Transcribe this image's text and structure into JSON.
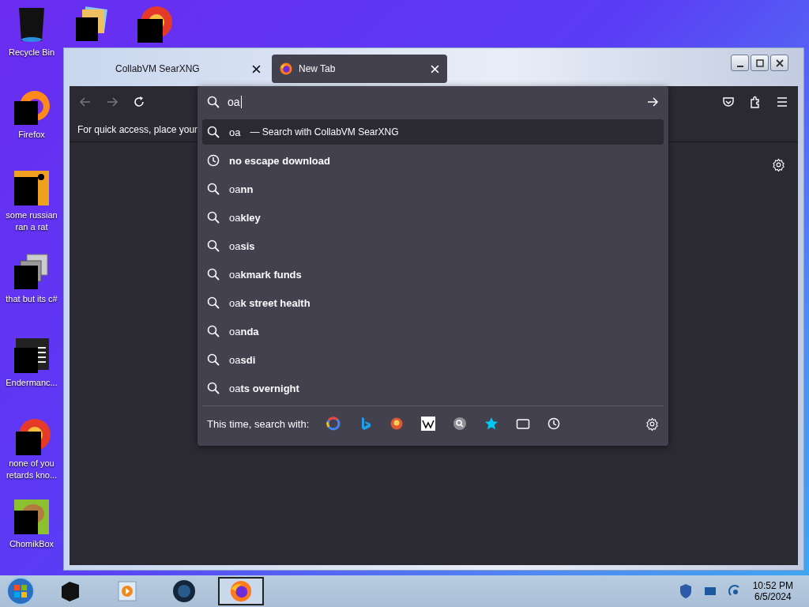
{
  "desktop_icons": [
    {
      "label": "Recycle Bin",
      "kind": "bin"
    },
    {
      "kind": "folder"
    },
    {
      "kind": "disc"
    },
    {
      "label": "Firefox",
      "kind": "firefox"
    },
    {
      "label": "some russian ran a rat",
      "kind": "doc"
    },
    {
      "label": "that but its c#",
      "kind": "stack"
    },
    {
      "label": "Endermanc...",
      "kind": "terminal"
    },
    {
      "label": "none of you retards kno...",
      "kind": "disc"
    },
    {
      "label": "ChomikBox",
      "kind": "box"
    }
  ],
  "tabs": [
    {
      "label": "CollabVM SearXNG",
      "selected": false
    },
    {
      "label": "New Tab",
      "selected": true
    }
  ],
  "bookmarks_bar": {
    "text": "For quick access, place your"
  },
  "address_bar": {
    "value": "oa"
  },
  "suggestions": [
    {
      "kind": "search",
      "text": "oa",
      "note": "— Search with CollabVM SearXNG",
      "selected": true
    },
    {
      "kind": "history",
      "text": "**no escape download**",
      "selected": false
    },
    {
      "kind": "search",
      "text": "oa**nn**",
      "selected": false
    },
    {
      "kind": "search",
      "text": "oa**kley**",
      "selected": false
    },
    {
      "kind": "search",
      "text": "oa**sis**",
      "selected": false
    },
    {
      "kind": "search",
      "text": "oa**kmark funds**",
      "selected": false
    },
    {
      "kind": "search",
      "text": "oa**k street health**",
      "selected": false
    },
    {
      "kind": "search",
      "text": "oa**nda**",
      "selected": false
    },
    {
      "kind": "search",
      "text": "oa**sdi**",
      "selected": false
    },
    {
      "kind": "search",
      "text": "oa**ts overnight**",
      "selected": false
    }
  ],
  "search_with": {
    "label": "This time, search with:"
  },
  "clock": {
    "time": "10:52 PM",
    "date": "6/5/2024"
  }
}
